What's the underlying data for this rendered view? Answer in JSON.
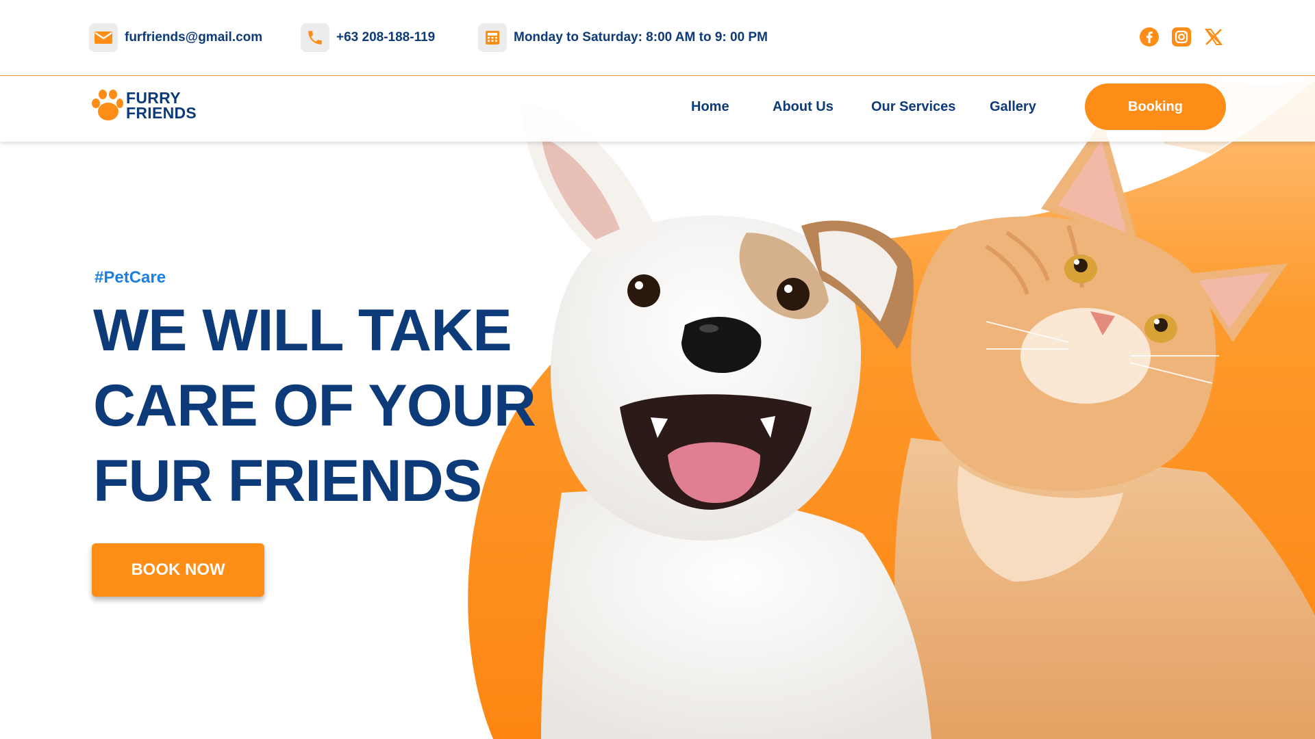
{
  "topbar": {
    "email": {
      "icon": "mail-icon",
      "text": "furfriends@gmail.com"
    },
    "phone": {
      "icon": "phone-icon",
      "text": "+63 208-188-119"
    },
    "hours": {
      "icon": "calendar-icon",
      "text": "Monday to Saturday: 8:00 AM to 9: 00 PM"
    },
    "social": [
      "facebook-icon",
      "instagram-icon",
      "x-icon"
    ]
  },
  "nav": {
    "logo_line1": "FURRY",
    "logo_line2": "FRIENDS",
    "links": [
      "Home",
      "About Us",
      "Our Services",
      "Gallery"
    ],
    "cta": "Booking"
  },
  "hero": {
    "tag": "#PetCare",
    "headline": [
      "WE WILL TAKE",
      "CARE OF YOUR",
      "FUR FRIENDS"
    ],
    "cta": "BOOK NOW",
    "image_subjects": [
      "dog-image",
      "cat-image"
    ]
  },
  "colors": {
    "brand_orange": "#fd8d17",
    "navy": "#0d3a78",
    "tag_blue": "#1a7fe0",
    "icon_bg": "#ececec"
  }
}
